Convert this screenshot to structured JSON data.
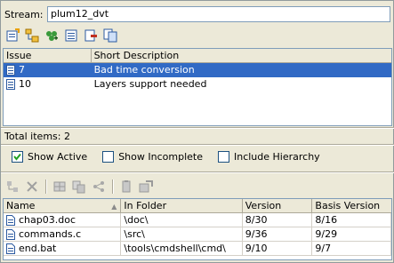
{
  "stream": {
    "label": "Stream:",
    "value": "plum12_dvt"
  },
  "top_toolbar": {
    "icons": [
      "new-issue-icon",
      "issue-tree-icon",
      "add-issue-icon",
      "issue-properties-icon",
      "remove-issue-icon",
      "copy-issue-icon"
    ]
  },
  "issues_table": {
    "columns": [
      "Issue",
      "Short Description"
    ],
    "rows": [
      {
        "issue": "7",
        "description": "Bad time conversion",
        "selected": true
      },
      {
        "issue": "10",
        "description": "Layers support needed",
        "selected": false
      }
    ]
  },
  "total": "Total items: 2",
  "checkboxes": {
    "show_active": {
      "label": "Show Active",
      "checked": true
    },
    "show_incomplete": {
      "label": "Show Incomplete",
      "checked": false
    },
    "include_hierarchy": {
      "label": "Include Hierarchy",
      "checked": false
    }
  },
  "bottom_toolbar": {
    "icons": [
      "move-icon",
      "delete-icon",
      "grid-icon",
      "copy-icon",
      "share-icon",
      "document-icon",
      "export-icon"
    ]
  },
  "files_table": {
    "columns": [
      "Name",
      "In Folder",
      "Version",
      "Basis Version"
    ],
    "rows": [
      {
        "name": "chap03.doc",
        "folder": "\\doc\\",
        "version": "8/30",
        "basis": "8/16"
      },
      {
        "name": "commands.c",
        "folder": "\\src\\",
        "version": "9/36",
        "basis": "9/29"
      },
      {
        "name": "end.bat",
        "folder": "\\tools\\cmdshell\\cmd\\",
        "version": "9/10",
        "basis": "9/7"
      }
    ]
  },
  "colors": {
    "selection": "#316ac5",
    "window_bg": "#ece9d8",
    "input_border": "#7f9db9"
  }
}
